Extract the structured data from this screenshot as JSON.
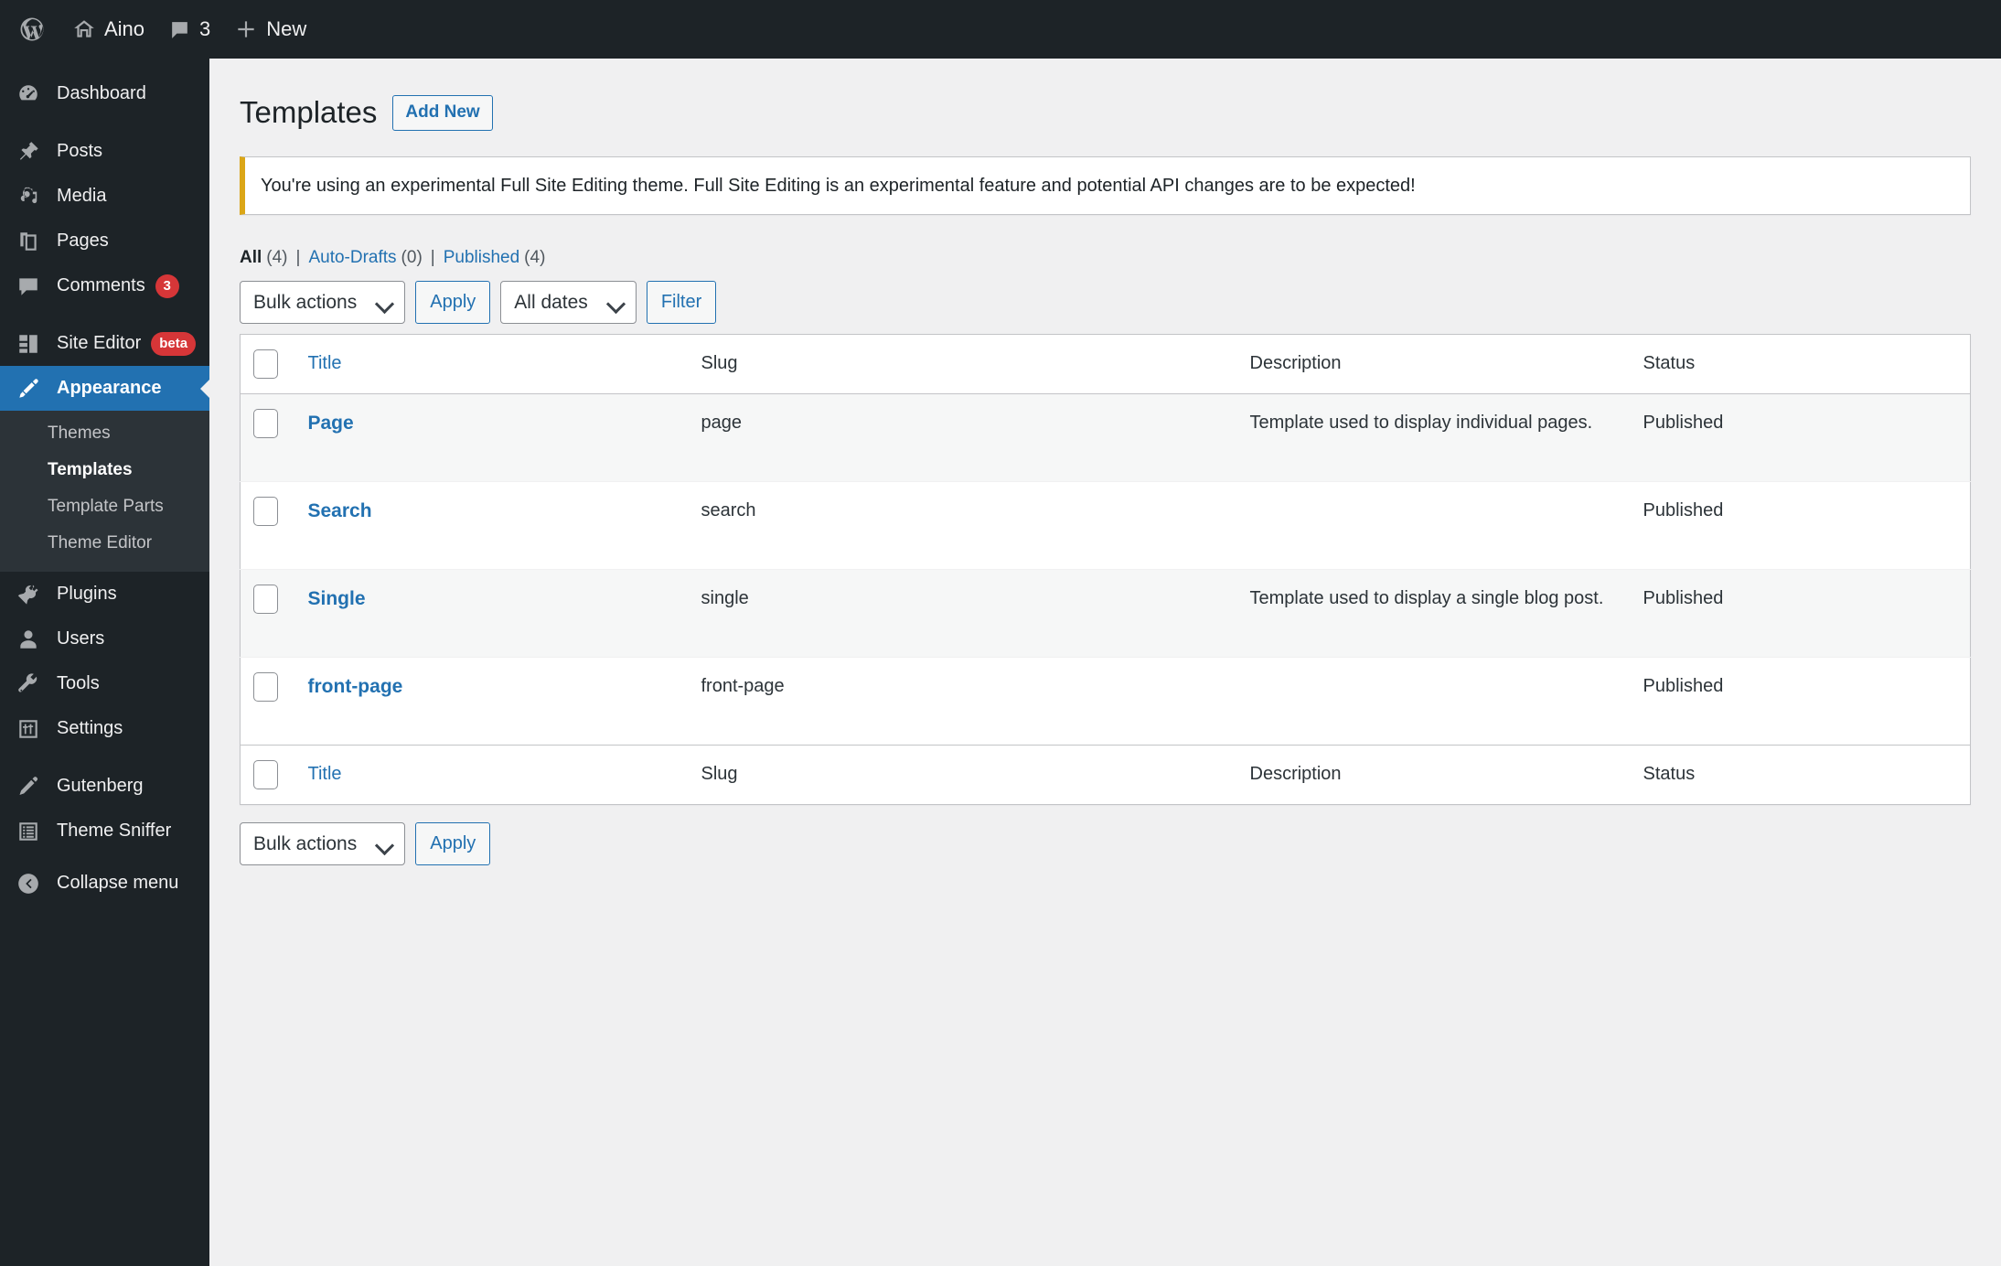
{
  "adminbar": {
    "logo_icon": "wordpress-logo-icon",
    "site_name": "Aino",
    "site_icon": "home-icon",
    "comments_icon": "comment-bubble-icon",
    "comments_count": "3",
    "new_icon": "plus-icon",
    "new_label": "New"
  },
  "sidebar": {
    "items": [
      {
        "label": "Dashboard",
        "icon": "dashboard-gauge-icon",
        "name": "dashboard"
      },
      {
        "label": "Posts",
        "icon": "pin-icon",
        "name": "posts"
      },
      {
        "label": "Media",
        "icon": "media-camera-music-icon",
        "name": "media"
      },
      {
        "label": "Pages",
        "icon": "pages-stack-icon",
        "name": "pages"
      },
      {
        "label": "Comments",
        "icon": "comment-bubble-icon",
        "name": "comments",
        "badge": "3"
      },
      {
        "label": "Site Editor",
        "icon": "site-editor-layout-icon",
        "name": "site-editor",
        "beta": "beta"
      },
      {
        "label": "Appearance",
        "icon": "paintbrush-icon",
        "name": "appearance",
        "current": true
      },
      {
        "label": "Plugins",
        "icon": "plug-icon",
        "name": "plugins"
      },
      {
        "label": "Users",
        "icon": "user-icon",
        "name": "users"
      },
      {
        "label": "Tools",
        "icon": "wrench-icon",
        "name": "tools"
      },
      {
        "label": "Settings",
        "icon": "sliders-icon",
        "name": "settings"
      },
      {
        "label": "Gutenberg",
        "icon": "pencil-icon",
        "name": "gutenberg"
      },
      {
        "label": "Theme Sniffer",
        "icon": "list-lines-icon",
        "name": "theme-sniffer"
      }
    ],
    "submenu": [
      {
        "label": "Themes",
        "name": "themes"
      },
      {
        "label": "Templates",
        "name": "templates",
        "current": true
      },
      {
        "label": "Template Parts",
        "name": "template-parts"
      },
      {
        "label": "Theme Editor",
        "name": "theme-editor"
      }
    ],
    "collapse": {
      "label": "Collapse menu",
      "icon": "collapse-arrow-icon"
    }
  },
  "main": {
    "title": "Templates",
    "add_new_label": "Add New",
    "notice": "You're using an experimental Full Site Editing theme. Full Site Editing is an experimental feature and potential API changes are to be expected!",
    "views": [
      {
        "label": "All",
        "count": "(4)",
        "current": true
      },
      {
        "label": "Auto-Drafts",
        "count": "(0)",
        "current": false
      },
      {
        "label": "Published",
        "count": "(4)",
        "current": false
      }
    ],
    "view_divider": "|",
    "tablenav_top": {
      "bulk_actions_value": "Bulk actions",
      "apply_label": "Apply",
      "dates_value": "All dates",
      "filter_label": "Filter"
    },
    "tablenav_bottom": {
      "bulk_actions_value": "Bulk actions",
      "apply_label": "Apply"
    },
    "table": {
      "columns": {
        "title": "Title",
        "slug": "Slug",
        "description": "Description",
        "status": "Status"
      },
      "rows": [
        {
          "title": "Page",
          "slug": "page",
          "description": "Template used to display individual pages.",
          "status": "Published"
        },
        {
          "title": "Search",
          "slug": "search",
          "description": "",
          "status": "Published"
        },
        {
          "title": "Single",
          "slug": "single",
          "description": "Template used to display a single blog post.",
          "status": "Published"
        },
        {
          "title": "front-page",
          "slug": "front-page",
          "description": "",
          "status": "Published"
        }
      ]
    }
  },
  "colors": {
    "admin_dark": "#1d2327",
    "admin_submenu": "#2c3338",
    "accent_blue": "#2271b1",
    "link_blue": "#2271b1",
    "badge_red": "#d63638",
    "notice_amber": "#dba617",
    "page_bg": "#f0f0f1"
  }
}
